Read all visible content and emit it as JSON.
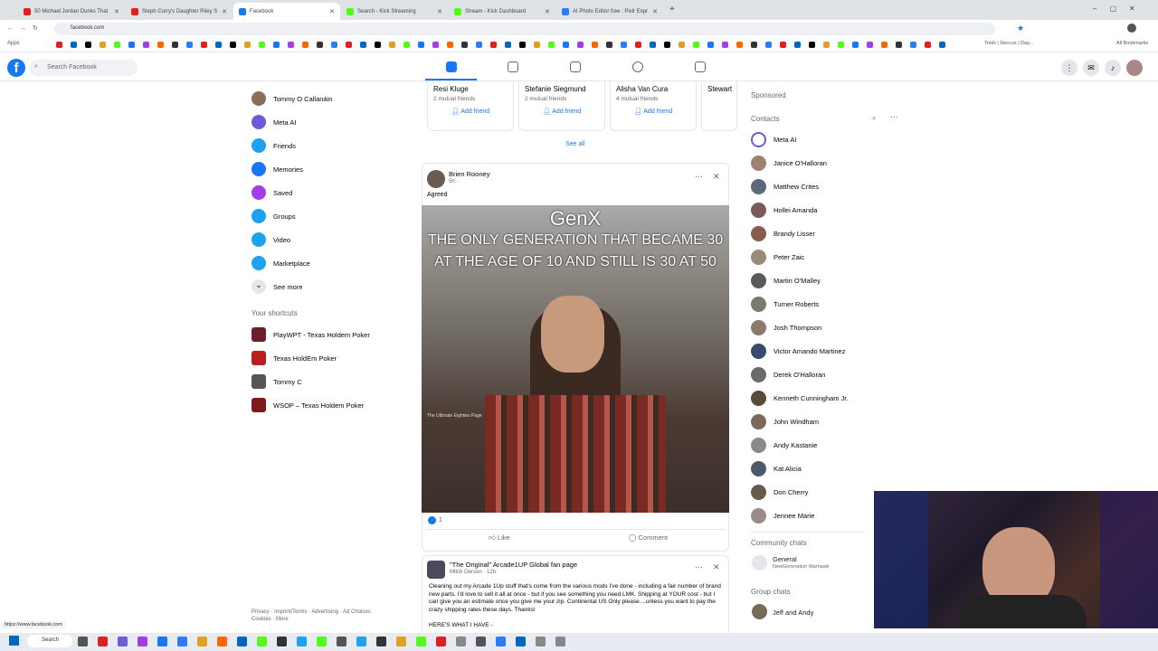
{
  "browser": {
    "tabs": [
      {
        "title": "50 Michael Jordan Dunks That",
        "color": "#e02020"
      },
      {
        "title": "Steph Curry's Daughter Riley S",
        "color": "#e02020"
      },
      {
        "title": "Facebook",
        "color": "#1877f2"
      },
      {
        "title": "Search - Kick Streaming",
        "color": "#53fc18"
      },
      {
        "title": "Stream - Kick Dashboard",
        "color": "#53fc18"
      },
      {
        "title": "AI Photo Editor free : Pixlr Expr",
        "color": "#2d7cf6"
      }
    ],
    "url": "facebook.com",
    "apps_label": "Apps",
    "tools_label": "Tools | Deccus | Day...",
    "all_bookmarks": "All Bookmarks",
    "status_url": "https://www.facebook.com"
  },
  "fb": {
    "search_placeholder": "Search Facebook",
    "left_nav": [
      {
        "label": "Tommy O Callanáin",
        "color": "#8a6d5a",
        "icon": "avatar"
      },
      {
        "label": "Meta AI",
        "color": "#6b5bd6",
        "icon": "meta-ai-icon"
      },
      {
        "label": "Friends",
        "color": "#1fa1f2",
        "icon": "friends-icon"
      },
      {
        "label": "Memories",
        "color": "#1877f2",
        "icon": "memories-icon"
      },
      {
        "label": "Saved",
        "color": "#a33ee6",
        "icon": "saved-icon"
      },
      {
        "label": "Groups",
        "color": "#1fa1f2",
        "icon": "groups-icon"
      },
      {
        "label": "Video",
        "color": "#1fa1f2",
        "icon": "video-icon"
      },
      {
        "label": "Marketplace",
        "color": "#1fa1f2",
        "icon": "marketplace-icon"
      },
      {
        "label": "See more",
        "color": "#e4e6eb",
        "icon": "chevron-down-icon"
      }
    ],
    "shortcuts_title": "Your shortcuts",
    "shortcuts": [
      {
        "label": "PlayWPT - Texas Holdem Poker",
        "color": "#6b1f2e"
      },
      {
        "label": "Texas HoldEm Poker",
        "color": "#b81f1f"
      },
      {
        "label": "Tommy C",
        "color": "#555"
      },
      {
        "label": "WSOP – Texas Holdem Poker",
        "color": "#7a1a1a"
      }
    ],
    "footer": "Privacy · Imprint/Terms · Advertising · Ad Choices",
    "footer2": "Cookies · More",
    "pymk": [
      {
        "name": "Resi Kluge",
        "mutual": "2 mutual friends",
        "action": "Add friend"
      },
      {
        "name": "Stefanie Siegmund",
        "mutual": "2 mutual friends",
        "action": "Add friend"
      },
      {
        "name": "Alisha Van Cura",
        "mutual": "4 mutual friends",
        "action": "Add friend"
      },
      {
        "name": "Stewart",
        "mutual": "",
        "action": ""
      }
    ],
    "see_all": "See all",
    "post1": {
      "author": "Brien Rooney",
      "time": "5h · ",
      "caption": "Agreed",
      "meme_title": "GenX",
      "meme_line1": "THE ONLY GENERATION THAT BECAME 30",
      "meme_line2": "AT THE AGE OF 10 AND STILL IS 30 AT 50",
      "meme_watermark": "The Ultimate Eighties Page",
      "reactions": "1",
      "like": "Like",
      "comment": "Comment"
    },
    "post2": {
      "group": "\"The Original\" Arcade1UP Global fan page",
      "author": "Mitch Gerson · 12h · ",
      "text": "Cleaning out my Arcade 1Up stuff that's come from the various mods I've done - including a fair number of brand new parts. I'd love to sell it all at once - but if you see something you need LMK. Shipping at YOUR cost - but I can give you an estimate once you give me your zip. Continental US Only please....unless you want to pay the crazy shipping rates these days. Thanks!",
      "more": "HERE'S WHAT I HAVE -"
    },
    "sponsored": "Sponsored",
    "contacts_title": "Contacts",
    "contacts": [
      "Meta AI",
      "Janice O'Halloran",
      "Matthew Crites",
      "Hollei Amanda",
      "Brandy Lisser",
      "Peter Zaic",
      "Martin O'Malley",
      "Turner Roberts",
      "Josh Thompson",
      "Victor Amando Martinez",
      "Derek O'Halloran",
      "Kenneth Cunningham Jr.",
      "John Windham",
      "Andy Kastanie",
      "Kat Alicia",
      "Don Cherry",
      "Jennee Marie"
    ],
    "community_title": "Community chats",
    "community_name": "General",
    "community_sub": "NewGeneration Warhawk",
    "group_title": "Group chats",
    "group_name": "Jeff and Andy"
  },
  "taskbar": {
    "search": "Search"
  }
}
